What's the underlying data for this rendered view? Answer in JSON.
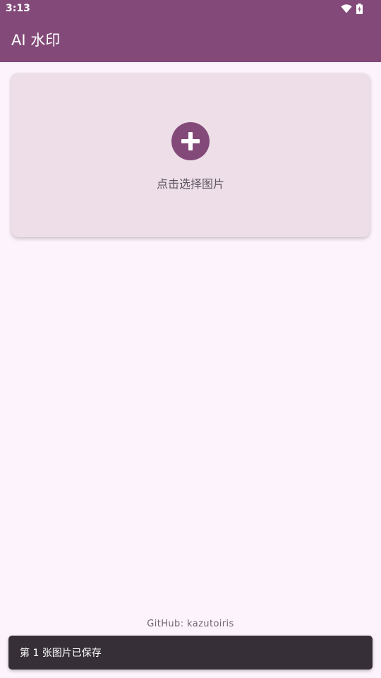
{
  "status_bar": {
    "time": "3:13",
    "wifi_icon": "wifi-icon",
    "battery_icon": "battery-charging-icon"
  },
  "app_bar": {
    "title": "AI 水印"
  },
  "image_picker": {
    "icon": "add-circle-icon",
    "label": "点击选择图片"
  },
  "footer": {
    "github": "GitHub: kazutoiris"
  },
  "snackbar": {
    "message": "第 1 张图片已保存"
  },
  "colors": {
    "primary": "#834A79",
    "background": "#FDF3FC",
    "card": "#EDDEE8",
    "snackbar": "#372F37"
  }
}
